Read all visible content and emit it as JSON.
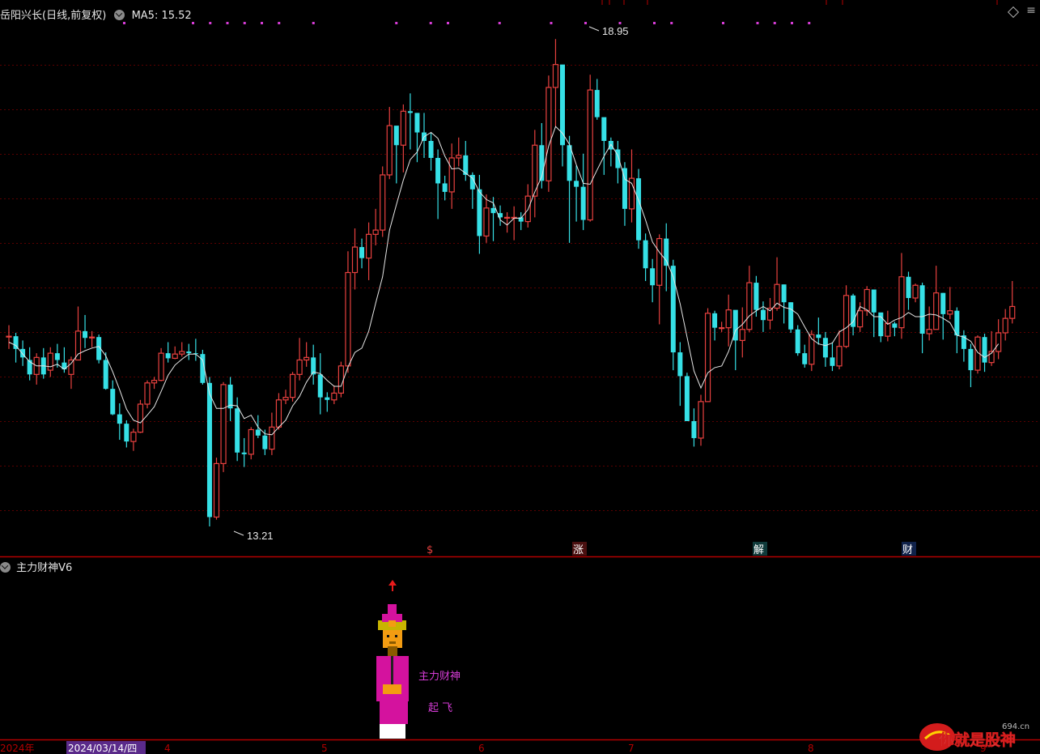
{
  "header": {
    "title": "岳阳兴长(日线,前复权)",
    "ma_label": "MA5: 15.52"
  },
  "indicator_panel": {
    "title": "主力财神V6",
    "label_1": "主力财神",
    "label_2": "起 飞"
  },
  "annotations": {
    "high_label": "18.95",
    "low_label": "13.21",
    "signal_markers": [
      "$",
      "涨",
      "解",
      "财"
    ]
  },
  "time_axis": {
    "labels": [
      "2024年",
      "2024/03/14/四",
      "4",
      "5",
      "6",
      "7",
      "8",
      "9"
    ]
  },
  "watermark": {
    "text": "你就是股神",
    "site": "694.cn"
  },
  "colors": {
    "up": "#e8413f",
    "down": "#36e0e6",
    "ma": "#e6e6e6",
    "grid": "#5a0000",
    "marker_dots": "#d63cd6",
    "axis": "#b30000",
    "figure_magenta": "#d4129e",
    "figure_orange": "#f39c12"
  },
  "chart_data": {
    "type": "candlestick",
    "title": "岳阳兴长(日线,前复权)",
    "ma_period": 5,
    "ma_latest": 15.52,
    "ylim": [
      13.0,
      19.2
    ],
    "period_high": 18.95,
    "period_low": 13.21,
    "month_ticks": [
      "2024年",
      "4",
      "5",
      "6",
      "7",
      "8",
      "9"
    ],
    "candles": [
      [
        15.45,
        15.45,
        15.58,
        15.3
      ],
      [
        15.45,
        15.3,
        15.49,
        15.14
      ],
      [
        15.3,
        15.2,
        15.4,
        15.1
      ],
      [
        15.17,
        15.0,
        15.32,
        14.93
      ],
      [
        15.0,
        15.2,
        15.25,
        14.88
      ],
      [
        15.2,
        15.0,
        15.31,
        14.95
      ],
      [
        15.05,
        15.25,
        15.32,
        14.97
      ],
      [
        15.25,
        15.17,
        15.36,
        15.08
      ],
      [
        15.14,
        15.06,
        15.32,
        15.02
      ],
      [
        15.0,
        15.17,
        15.21,
        14.83
      ],
      [
        15.17,
        15.51,
        15.8,
        15.17
      ],
      [
        15.51,
        15.43,
        15.7,
        15.31
      ],
      [
        15.43,
        15.44,
        15.51,
        15.32
      ],
      [
        15.44,
        15.17,
        15.47,
        15.13
      ],
      [
        15.17,
        14.83,
        15.26,
        14.82
      ],
      [
        14.83,
        14.53,
        14.93,
        14.52
      ],
      [
        14.53,
        14.42,
        14.66,
        14.23
      ],
      [
        14.42,
        14.21,
        14.46,
        14.14
      ],
      [
        14.21,
        14.32,
        14.36,
        14.1
      ],
      [
        14.32,
        14.65,
        14.7,
        14.31
      ],
      [
        14.65,
        14.9,
        14.93,
        14.6
      ],
      [
        14.9,
        14.93,
        14.97,
        14.83
      ],
      [
        14.93,
        15.25,
        15.31,
        14.92
      ],
      [
        15.25,
        15.19,
        15.38,
        15.14
      ],
      [
        15.19,
        15.24,
        15.33,
        15.18
      ],
      [
        15.24,
        15.27,
        15.38,
        15.21
      ],
      [
        15.27,
        15.25,
        15.36,
        15.17
      ],
      [
        15.25,
        15.24,
        15.42,
        15.16
      ],
      [
        15.24,
        14.9,
        15.29,
        14.88
      ],
      [
        14.9,
        13.32,
        14.97,
        13.21
      ],
      [
        13.32,
        13.95,
        14.02,
        13.29
      ],
      [
        13.95,
        14.88,
        14.91,
        13.85
      ],
      [
        14.88,
        14.6,
        14.97,
        14.45
      ],
      [
        14.6,
        14.08,
        14.73,
        13.98
      ],
      [
        14.08,
        14.06,
        14.25,
        13.91
      ],
      [
        14.06,
        14.35,
        14.38,
        14.0
      ],
      [
        14.35,
        14.28,
        14.52,
        14.25
      ],
      [
        14.28,
        14.12,
        14.35,
        14.05
      ],
      [
        14.12,
        14.38,
        14.55,
        14.05
      ],
      [
        14.38,
        14.7,
        14.78,
        14.35
      ],
      [
        14.7,
        14.73,
        14.82,
        14.65
      ],
      [
        14.73,
        15.0,
        15.03,
        14.68
      ],
      [
        15.0,
        15.17,
        15.43,
        14.93
      ],
      [
        15.17,
        15.2,
        15.38,
        15.09
      ],
      [
        15.2,
        15.0,
        15.35,
        14.88
      ],
      [
        15.0,
        14.73,
        15.25,
        14.53
      ],
      [
        14.73,
        14.7,
        14.79,
        14.56
      ],
      [
        14.7,
        14.78,
        14.87,
        14.65
      ],
      [
        14.78,
        15.1,
        15.15,
        14.73
      ],
      [
        15.1,
        16.2,
        16.45,
        15.02
      ],
      [
        16.2,
        16.5,
        16.72,
        16.0
      ],
      [
        16.5,
        16.37,
        16.6,
        16.25
      ],
      [
        16.37,
        16.65,
        16.79,
        16.11
      ],
      [
        16.65,
        16.7,
        16.95,
        16.52
      ],
      [
        16.7,
        17.35,
        17.45,
        16.62
      ],
      [
        17.35,
        17.93,
        18.15,
        17.3
      ],
      [
        17.93,
        17.7,
        17.92,
        17.25
      ],
      [
        17.7,
        18.1,
        18.18,
        17.38
      ],
      [
        18.1,
        18.08,
        18.31,
        17.65
      ],
      [
        18.08,
        17.85,
        17.96,
        17.5
      ],
      [
        17.85,
        17.75,
        18.08,
        17.55
      ],
      [
        17.75,
        17.55,
        17.85,
        17.4
      ],
      [
        17.55,
        17.25,
        17.65,
        16.83
      ],
      [
        17.25,
        17.15,
        17.34,
        17.05
      ],
      [
        17.15,
        17.55,
        17.72,
        16.95
      ],
      [
        17.55,
        17.58,
        17.79,
        17.45
      ],
      [
        17.58,
        17.35,
        17.75,
        17.28
      ],
      [
        17.35,
        17.18,
        17.38,
        16.95
      ],
      [
        17.18,
        16.63,
        17.35,
        16.42
      ],
      [
        16.63,
        16.96,
        17.12,
        16.55
      ],
      [
        16.96,
        16.9,
        17.09,
        16.57
      ],
      [
        16.9,
        16.85,
        16.99,
        16.75
      ],
      [
        16.85,
        16.85,
        16.91,
        16.67
      ],
      [
        16.85,
        16.85,
        16.98,
        16.58
      ],
      [
        16.85,
        16.8,
        16.91,
        16.7
      ],
      [
        16.8,
        17.1,
        17.24,
        16.73
      ],
      [
        17.1,
        17.7,
        17.88,
        16.85
      ],
      [
        17.7,
        17.28,
        17.96,
        17.19
      ],
      [
        17.28,
        18.38,
        18.52,
        17.15
      ],
      [
        18.38,
        18.65,
        18.95,
        17.92
      ],
      [
        18.65,
        17.7,
        18.03,
        17.45
      ],
      [
        17.7,
        17.28,
        17.81,
        16.55
      ],
      [
        17.28,
        17.21,
        17.46,
        16.8
      ],
      [
        17.21,
        16.82,
        17.6,
        16.7
      ],
      [
        16.82,
        18.35,
        18.53,
        16.8
      ],
      [
        18.35,
        18.03,
        18.48,
        18.0
      ],
      [
        18.03,
        17.75,
        18.01,
        17.35
      ],
      [
        17.75,
        17.65,
        17.79,
        17.45
      ],
      [
        17.65,
        17.43,
        17.75,
        17.25
      ],
      [
        17.43,
        16.95,
        17.5,
        16.75
      ],
      [
        16.95,
        17.31,
        17.65,
        16.79
      ],
      [
        17.31,
        16.58,
        17.42,
        16.48
      ],
      [
        16.58,
        16.25,
        16.66,
        16.1
      ],
      [
        16.25,
        16.05,
        16.36,
        15.85
      ],
      [
        16.05,
        16.6,
        16.65,
        15.59
      ],
      [
        16.6,
        16.28,
        16.78,
        15.98
      ],
      [
        16.28,
        15.26,
        16.35,
        15.05
      ],
      [
        15.26,
        14.98,
        15.38,
        14.63
      ],
      [
        14.98,
        14.45,
        15.02,
        14.47
      ],
      [
        14.45,
        14.25,
        14.6,
        14.15
      ],
      [
        14.25,
        14.68,
        14.76,
        14.16
      ],
      [
        14.68,
        15.72,
        15.78,
        14.68
      ],
      [
        15.72,
        15.55,
        15.75,
        15.4
      ],
      [
        15.55,
        15.55,
        15.62,
        15.5
      ],
      [
        15.55,
        15.76,
        15.94,
        15.33
      ],
      [
        15.76,
        15.4,
        15.72,
        15.05
      ],
      [
        15.4,
        15.53,
        15.79,
        15.2
      ],
      [
        15.53,
        16.08,
        16.28,
        15.5
      ],
      [
        16.08,
        15.76,
        16.16,
        15.68
      ],
      [
        15.76,
        15.64,
        15.86,
        15.5
      ],
      [
        15.64,
        15.78,
        15.9,
        15.53
      ],
      [
        15.78,
        16.06,
        16.38,
        15.75
      ],
      [
        16.06,
        15.85,
        16.06,
        15.6
      ],
      [
        15.85,
        15.53,
        15.85,
        15.49
      ],
      [
        15.53,
        15.25,
        15.58,
        15.22
      ],
      [
        15.25,
        15.12,
        15.35,
        15.08
      ],
      [
        15.12,
        15.47,
        15.52,
        15.04
      ],
      [
        15.47,
        15.43,
        15.67,
        15.35
      ],
      [
        15.43,
        15.2,
        15.5,
        15.09
      ],
      [
        15.2,
        15.1,
        15.38,
        15.04
      ],
      [
        15.1,
        15.33,
        15.52,
        15.06
      ],
      [
        15.33,
        15.93,
        16.05,
        15.31
      ],
      [
        15.93,
        15.56,
        15.95,
        15.46
      ],
      [
        15.56,
        15.75,
        15.85,
        15.5
      ],
      [
        15.75,
        16.0,
        16.04,
        15.69
      ],
      [
        16.0,
        15.73,
        15.99,
        15.44
      ],
      [
        15.73,
        15.45,
        15.71,
        15.38
      ],
      [
        15.45,
        15.6,
        15.75,
        15.39
      ],
      [
        15.6,
        15.55,
        15.62,
        15.45
      ],
      [
        15.55,
        16.15,
        16.43,
        15.42
      ],
      [
        16.15,
        15.9,
        16.21,
        15.76
      ],
      [
        15.9,
        16.05,
        16.07,
        15.85
      ],
      [
        16.05,
        15.48,
        16.08,
        15.25
      ],
      [
        15.48,
        15.53,
        15.8,
        15.4
      ],
      [
        15.53,
        15.96,
        16.28,
        15.68
      ],
      [
        15.96,
        15.71,
        15.96,
        15.41
      ],
      [
        15.71,
        15.75,
        16.03,
        15.65
      ],
      [
        15.75,
        15.46,
        15.79,
        15.25
      ],
      [
        15.46,
        15.3,
        15.52,
        15.15
      ],
      [
        15.3,
        15.05,
        15.36,
        14.85
      ],
      [
        15.05,
        15.44,
        15.46,
        15.01
      ],
      [
        15.44,
        15.14,
        15.48,
        15.03
      ],
      [
        15.14,
        15.27,
        15.51,
        15.1
      ],
      [
        15.27,
        15.49,
        15.65,
        15.18
      ],
      [
        15.49,
        15.66,
        15.77,
        15.4
      ],
      [
        15.66,
        15.8,
        16.1,
        15.6
      ]
    ],
    "ma5": [
      15.38,
      15.34,
      15.24,
      15.15,
      15.1,
      15.1,
      15.09,
      15.12,
      15.06,
      15.13,
      15.24,
      15.28,
      15.31,
      15.33,
      15.22,
      15.03,
      14.82,
      14.59,
      14.46,
      14.43,
      14.52,
      14.62,
      14.8,
      14.99,
      15.11,
      15.18,
      15.24,
      15.24,
      15.17,
      14.77,
      14.6,
      14.6,
      14.64,
      14.63,
      14.48,
      14.52,
      14.38,
      14.3,
      14.29,
      14.38,
      14.46,
      14.63,
      14.74,
      14.91,
      15.03,
      15.01,
      14.93,
      14.86,
      14.86,
      15.09,
      15.26,
      15.31,
      15.51,
      15.84,
      16.15,
      16.7,
      17.0,
      17.29,
      17.53,
      17.62,
      17.8,
      17.85,
      17.78,
      17.57,
      17.42,
      17.43,
      17.37,
      17.31,
      17.15,
      17.06,
      17.02,
      16.82,
      16.76,
      16.84,
      16.84,
      16.94,
      17.15,
      17.33,
      17.69,
      17.92,
      17.84,
      17.71,
      17.47,
      17.25,
      17.24,
      17.41,
      17.57,
      17.71,
      17.58,
      17.3,
      17.25,
      17.05,
      16.82,
      16.56,
      16.44,
      16.34,
      16.15,
      15.83,
      15.44,
      15.04,
      14.84,
      15.02,
      15.08,
      15.1,
      15.27,
      15.52,
      15.59,
      15.69,
      15.75,
      15.8,
      15.75,
      15.84,
      15.79,
      15.77,
      15.71,
      15.56,
      15.42,
      15.36,
      15.34,
      15.37,
      15.5,
      15.55,
      15.62,
      15.8,
      15.76,
      15.68,
      15.68,
      15.59,
      15.64,
      15.67,
      15.73,
      15.68,
      15.68,
      15.71,
      15.7,
      15.66,
      15.61,
      15.46,
      15.44,
      15.39,
      15.26,
      15.2,
      15.25,
      15.36
    ],
    "top_marker_dots": [
      1,
      5,
      6,
      7,
      8,
      9,
      10,
      12,
      14,
      16,
      17,
      20,
      23,
      25,
      27,
      29,
      30,
      33,
      35,
      36,
      37,
      38
    ]
  }
}
